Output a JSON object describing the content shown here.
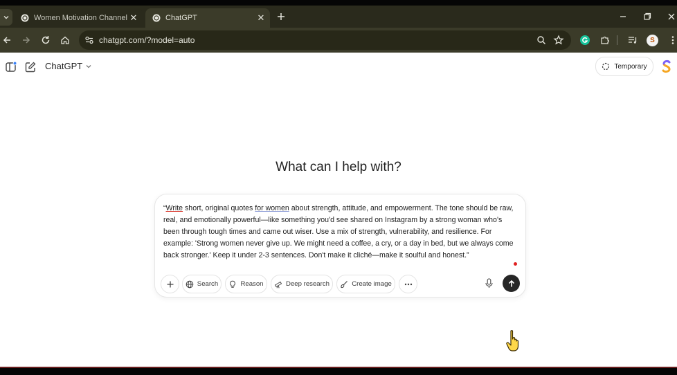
{
  "browser": {
    "tabs": [
      {
        "title": "Women Motivation Channel Ide",
        "active": false,
        "favicon": "chatgpt-favicon"
      },
      {
        "title": "ChatGPT",
        "active": true,
        "favicon": "chatgpt-favicon"
      }
    ],
    "url": "chatgpt.com/?model=auto",
    "profile_initial": "S"
  },
  "app": {
    "model_label": "ChatGPT",
    "temporary_label": "Temporary",
    "heading": "What can I help with?"
  },
  "composer": {
    "prompt_parts": [
      "“",
      "Write",
      " short, original quotes ",
      "for women",
      " about strength, attitude, and empowerment. The tone should be raw, real, and emotionally powerful—like something you'd see shared on Instagram by a strong woman who's been through tough times and came out wiser. Use a mix of strength, vulnerability, and resilience. For example: 'Strong women never give up. We might need a coffee, a cry, or a day in bed, but we always come back stronger.' Keep it under 2-3 sentences. Don't make it cliché—make it soulful and honest.”"
    ],
    "tools": {
      "search": "Search",
      "reason": "Reason",
      "deep_research": "Deep research",
      "create_image": "Create image"
    }
  },
  "colors": {
    "tab_bar": "#2a2a1c",
    "toolbar": "#3b3b29",
    "send_button": "#262626",
    "spellcheck_underline": "#d93025"
  }
}
